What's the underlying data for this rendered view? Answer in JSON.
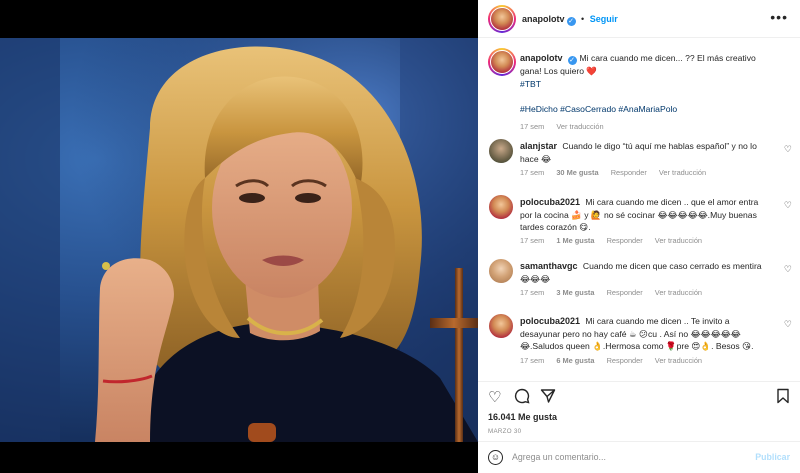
{
  "header": {
    "username": "anapolotv",
    "verified": true,
    "dot": "•",
    "follow_label": "Seguir",
    "more_icon": "more-horizontal-icon"
  },
  "caption": {
    "username": "anapolotv",
    "text": "Mi cara cuando me dicen... ?? El más creativo gana! Los quiero ❤️",
    "hashtag_line1": "#TBT",
    "hashtag_line2": "#HeDicho #CasoCerrado #AnaMariaPolo",
    "time": "17 sem",
    "translate": "Ver traducción"
  },
  "comments": [
    {
      "username": "alanjstar",
      "text": "Cuando le digo “tú aquí me hablas español” y no lo hace 😂",
      "time": "17 sem",
      "likes": "30 Me gusta",
      "reply": "Responder",
      "translate": "Ver traducción"
    },
    {
      "username": "polocuba2021",
      "text": "Mi cara cuando me dicen .. que el amor entra por la cocina 🍰 y 🙋 no sé cocinar 😂😂😂😂😂.Muy buenas tardes corazón 😋.",
      "time": "17 sem",
      "likes": "1 Me gusta",
      "reply": "Responder",
      "translate": "Ver traducción"
    },
    {
      "username": "samanthavgc",
      "text": "Cuando me dicen que caso cerrado es mentira 😂😂😂",
      "time": "17 sem",
      "likes": "3 Me gusta",
      "reply": "Responder",
      "translate": "Ver traducción"
    },
    {
      "username": "polocuba2021",
      "text": "Mi cara cuando me dicen .. Te invito a desayunar pero no hay café ☕ 😕cu . Así no 😂😂😂😂😂😂.Saludos queen 👌.Hermosa como 🌹pre 😍👌. Besos 😘.",
      "time": "17 sem",
      "likes": "6 Me gusta",
      "reply": "Responder",
      "translate": "Ver traducción"
    }
  ],
  "actions": {
    "like_icon": "heart-icon",
    "comment_icon": "comment-icon",
    "share_icon": "paper-plane-icon",
    "save_icon": "bookmark-icon"
  },
  "likes_count": "16.041 Me gusta",
  "post_date": "MARZO 30",
  "add_comment": {
    "placeholder": "Agrega un comentario...",
    "publish_label": "Publicar"
  },
  "colors": {
    "accent": "#0095f6",
    "verified": "#3897f0",
    "muted": "#8e8e8e",
    "publish_disabled": "#b2dffc",
    "heart_emoji": "#e0245e"
  }
}
